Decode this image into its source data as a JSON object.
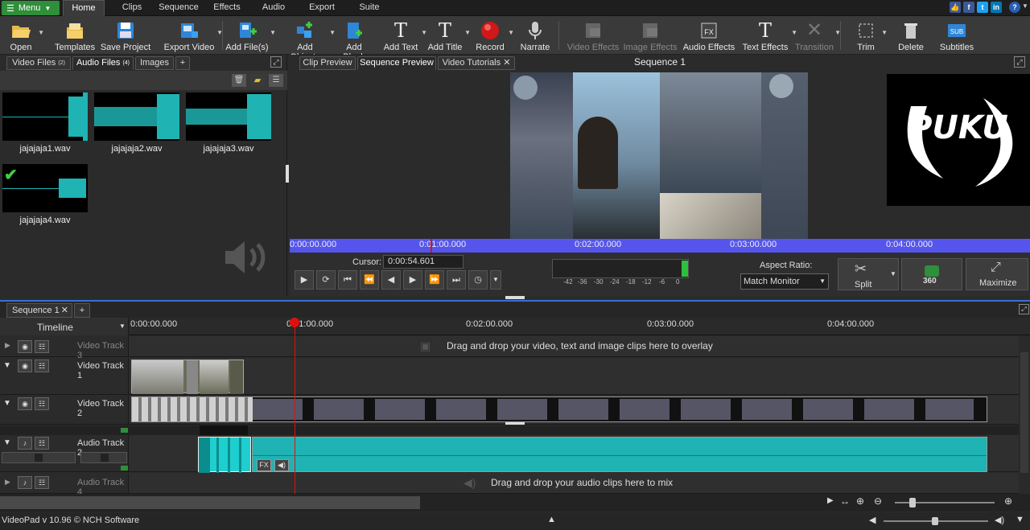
{
  "menubar": {
    "menu_label": "Menu",
    "tabs": [
      "Home",
      "Clips",
      "Sequence",
      "Effects",
      "Audio",
      "Export",
      "Suite"
    ],
    "active_tab": "Home",
    "help_label": "?"
  },
  "toolbar": {
    "buttons": [
      {
        "label": "Open",
        "icon": "folder-open-icon"
      },
      {
        "label": "Templates",
        "icon": "templates-icon"
      },
      {
        "label": "Save Project",
        "icon": "save-icon"
      },
      {
        "label": "Export Video",
        "icon": "export-video-icon"
      },
      {
        "label": "Add File(s)",
        "icon": "add-files-icon"
      },
      {
        "label": "Add Objects",
        "icon": "add-objects-icon"
      },
      {
        "label": "Add Blank",
        "icon": "add-blank-icon"
      },
      {
        "label": "Add Text",
        "icon": "add-text-icon"
      },
      {
        "label": "Add Title",
        "icon": "add-title-icon"
      },
      {
        "label": "Record",
        "icon": "record-icon"
      },
      {
        "label": "Narrate",
        "icon": "microphone-icon"
      },
      {
        "label": "Video Effects",
        "icon": "video-effects-icon"
      },
      {
        "label": "Image Effects",
        "icon": "image-effects-icon"
      },
      {
        "label": "Audio Effects",
        "icon": "audio-effects-icon"
      },
      {
        "label": "Text Effects",
        "icon": "text-effects-icon"
      },
      {
        "label": "Transition",
        "icon": "transition-icon"
      },
      {
        "label": "Trim",
        "icon": "trim-icon"
      },
      {
        "label": "Delete",
        "icon": "trash-icon"
      },
      {
        "label": "Subtitles",
        "icon": "subtitles-icon"
      }
    ],
    "text_icon_glyph": "T",
    "fx_icon_glyph": "FX",
    "sub_icon_glyph": "SUB"
  },
  "media_panel": {
    "tabs": [
      {
        "label": "Video Files",
        "count": "(2)"
      },
      {
        "label": "Audio Files",
        "count": "(4)"
      },
      {
        "label": "Images",
        "count": ""
      },
      {
        "label": "+",
        "count": ""
      }
    ],
    "active_tab": "Audio Files",
    "clips": [
      "jajajaja1.wav",
      "jajajaja2.wav",
      "jajajaja3.wav",
      "jajajaja4.wav"
    ],
    "checked_clip": "jajajaja4.wav"
  },
  "preview": {
    "tabs": [
      "Clip Preview",
      "Sequence Preview",
      "Video Tutorials"
    ],
    "active_tab": "Sequence Preview",
    "title": "Sequence 1",
    "ruler": [
      "0:00:00.000",
      "0:01:00.000",
      "0:02:00.000",
      "0:03:00.000",
      "0:04:00.000"
    ],
    "cursor_label": "Cursor:",
    "cursor_value": "0:00:54.601",
    "meter_labels": [
      "-42",
      "-36",
      "-30",
      "-24",
      "-18",
      "-12",
      "-6",
      "0"
    ],
    "aspect_ratio_label": "Aspect Ratio:",
    "aspect_ratio_value": "Match Monitor",
    "split_label": "Split",
    "vr_label": "360",
    "maximize_label": "Maximize",
    "logo_text": "PUKU"
  },
  "sequence": {
    "tab_label": "Sequence 1",
    "add_tab": "+",
    "timeline_label": "Timeline",
    "ruler": [
      "0:00:00.000",
      "0:01:00.000",
      "0:02:00.000",
      "0:03:00.000",
      "0:04:00.000"
    ],
    "tracks": [
      {
        "name": "Video Track 3",
        "hint": "Drag and drop your video, text and image clips here to overlay"
      },
      {
        "name": "Video Track 1",
        "hint": ""
      },
      {
        "name": "Video Track 2",
        "hint": ""
      },
      {
        "name": "Audio Track 2",
        "hint": ""
      },
      {
        "name": "Audio Track 4",
        "hint": "Drag and drop your audio clips here to mix"
      }
    ],
    "fx_label": "FX"
  },
  "status": {
    "version": "VideoPad v 10.96 © NCH Software"
  },
  "colors": {
    "menu_green": "#2f8f3a",
    "ruler_blue": "#5555ee",
    "playhead_red": "#e01010",
    "audio_teal": "#1fb3b3"
  }
}
